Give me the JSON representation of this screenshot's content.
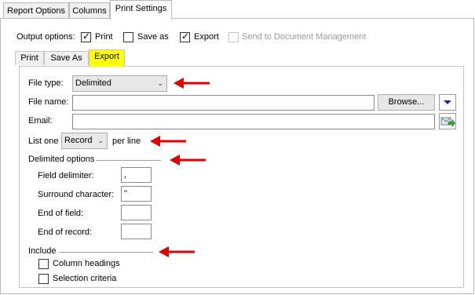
{
  "tabs": [
    {
      "label": "Report Options"
    },
    {
      "label": "Columns"
    },
    {
      "label": "Print Settings"
    }
  ],
  "output_options": {
    "label": "Output options:",
    "print": {
      "label": "Print",
      "checked": true
    },
    "save_as": {
      "label": "Save as",
      "checked": false
    },
    "export": {
      "label": "Export",
      "checked": true
    },
    "send_to_dm": {
      "label": "Send to Document Management",
      "checked": false,
      "disabled": true
    }
  },
  "subtabs": [
    {
      "label": "Print"
    },
    {
      "label": "Save As"
    },
    {
      "label": "Export"
    }
  ],
  "export": {
    "file_type": {
      "label": "File type:",
      "value": "Delimited"
    },
    "file_name": {
      "label": "File name:",
      "value": "",
      "browse_label": "Browse..."
    },
    "email": {
      "label": "Email:",
      "value": ""
    },
    "list_one": {
      "prefix": "List one",
      "value": "Record",
      "suffix": "per line"
    },
    "delimited_options": {
      "title": "Delimited options",
      "field_delimiter": {
        "label": "Field delimiter:",
        "value": ","
      },
      "surround_character": {
        "label": "Surround character:",
        "value": "\""
      },
      "end_of_field": {
        "label": "End of field:",
        "value": ""
      },
      "end_of_record": {
        "label": "End of record:",
        "value": ""
      }
    },
    "include": {
      "title": "Include",
      "column_headings": {
        "label": "Column headings",
        "checked": false
      },
      "selection_criteria": {
        "label": "Selection criteria",
        "checked": false
      }
    }
  },
  "colors": {
    "annotation_arrow": "#e00000",
    "active_subtab": "#ffff00"
  },
  "icons": [
    "chevron-down-icon",
    "triangle-down-icon",
    "email-send-icon",
    "check-icon",
    "red-arrow-icon"
  ]
}
